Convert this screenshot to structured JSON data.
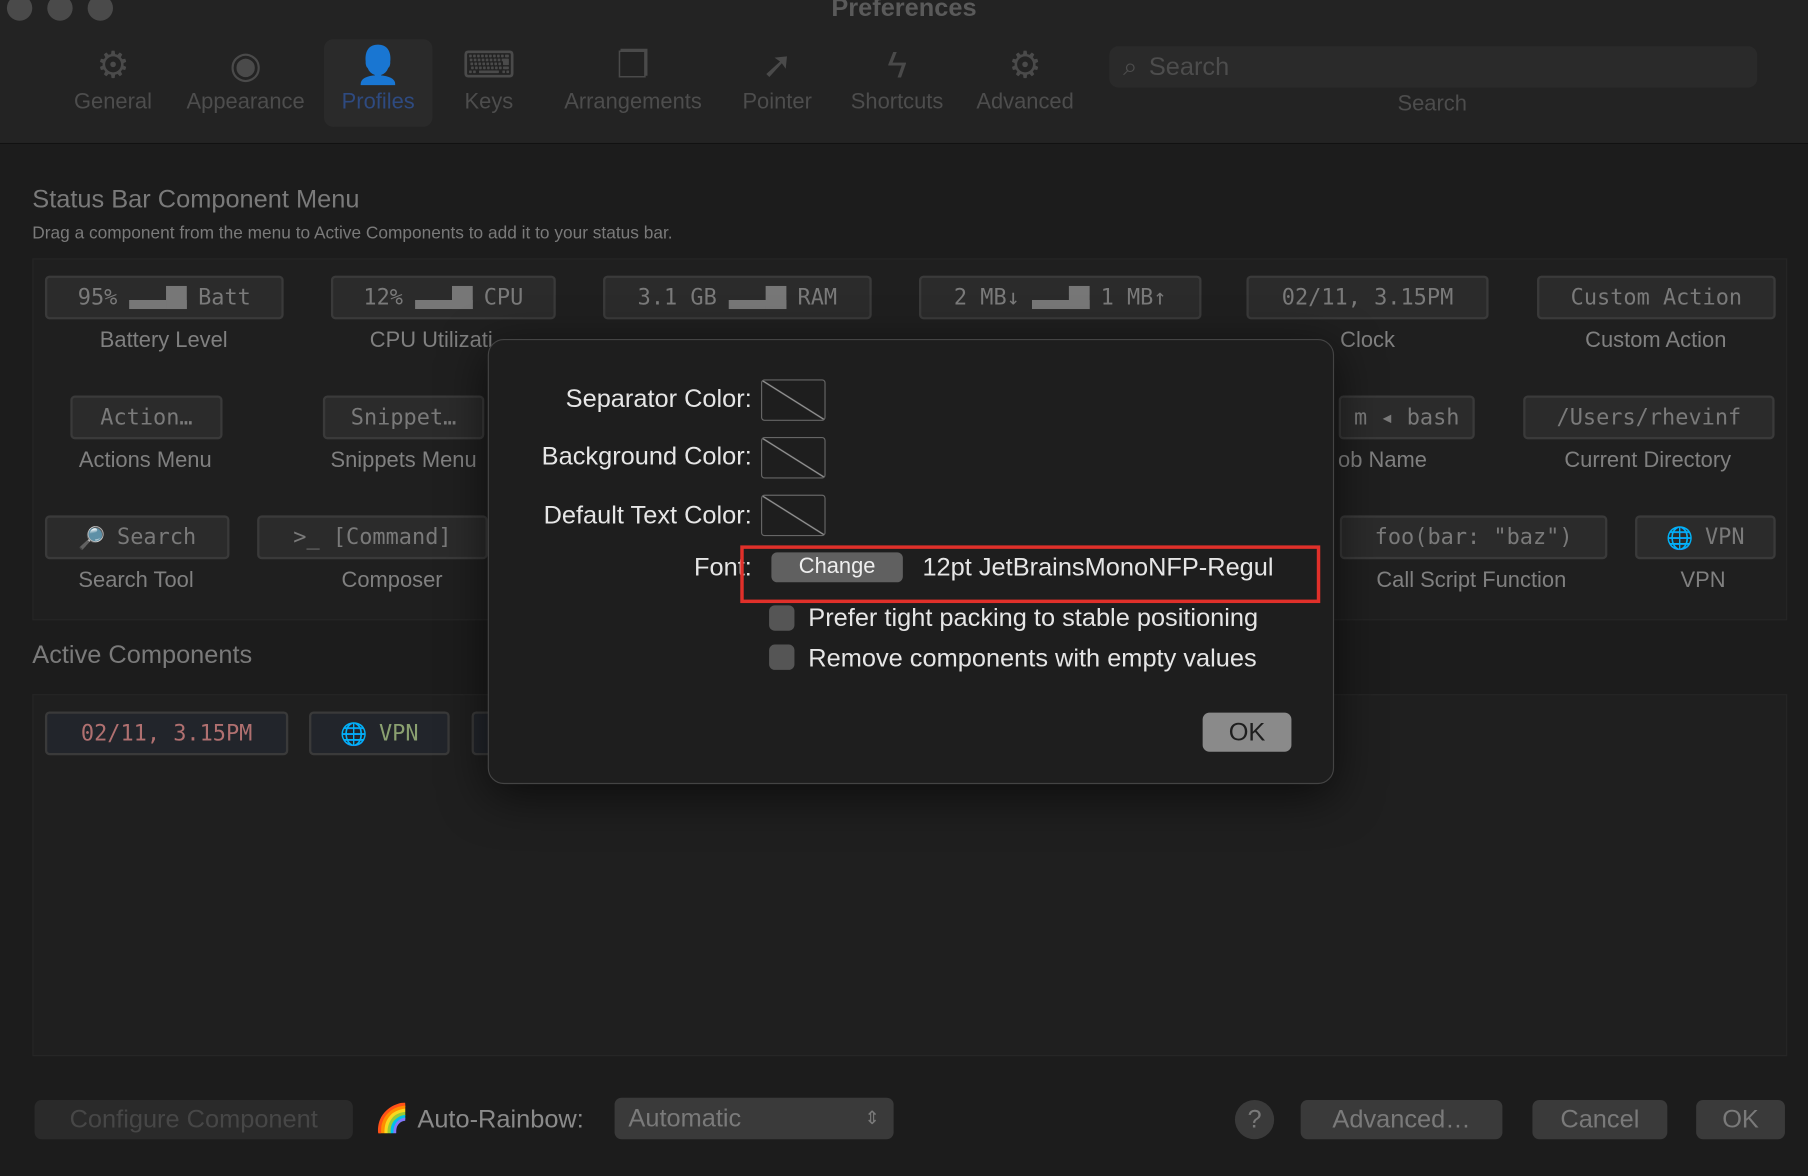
{
  "window": {
    "title": "Preferences"
  },
  "toolbar": {
    "items": [
      {
        "label": "General",
        "icon": "gear-icon",
        "glyph": "⚙"
      },
      {
        "label": "Appearance",
        "icon": "eye-icon",
        "glyph": "◉"
      },
      {
        "label": "Profiles",
        "icon": "person-icon",
        "glyph": "👤"
      },
      {
        "label": "Keys",
        "icon": "keyboard-icon",
        "glyph": "⌨"
      },
      {
        "label": "Arrangements",
        "icon": "windows-icon",
        "glyph": "❐"
      },
      {
        "label": "Pointer",
        "icon": "pointer-icon",
        "glyph": "➚"
      },
      {
        "label": "Shortcuts",
        "icon": "bolt-icon",
        "glyph": "ϟ"
      },
      {
        "label": "Advanced",
        "icon": "gears-icon",
        "glyph": "⚙"
      }
    ],
    "selected": "Profiles",
    "search_placeholder": "Search",
    "search_label": "Search"
  },
  "menu": {
    "title": "Status Bar Component Menu",
    "subtitle": "Drag a component from the menu to Active Components to add it to your status bar.",
    "components": [
      {
        "chip": "95%",
        "chip2": "Batt",
        "label": "Battery Level"
      },
      {
        "chip": "12%",
        "chip2": "CPU",
        "label": "CPU Utilizati"
      },
      {
        "chip": "3.1 GB",
        "chip2": "RAM",
        "label": ""
      },
      {
        "chip": "2 MB↓",
        "chip2": "1 MB↑",
        "label": ""
      },
      {
        "chip": "02/11, 3.15PM",
        "label": "Clock"
      },
      {
        "chip": "Custom Action",
        "label": "Custom Action"
      },
      {
        "chip": "Action…",
        "label": "Actions Menu"
      },
      {
        "chip": "Snippet…",
        "label": "Snippets Menu"
      },
      {
        "chip": "m ◂ bash",
        "label": "ob Name"
      },
      {
        "chip": "/Users/rhevinf",
        "label": "Current Directory"
      },
      {
        "chip": "Search",
        "label": "Search Tool"
      },
      {
        "chip": ">_ [Command]",
        "label": "Composer"
      },
      {
        "chip": "foo(bar: \"baz\")",
        "label": "Call Script Function"
      },
      {
        "chip": "VPN",
        "label": "VPN"
      }
    ]
  },
  "active": {
    "title": "Active Components",
    "items": [
      {
        "chip": "02/11, 3.15PM",
        "color": "#b07070"
      },
      {
        "chip": "VPN",
        "color": "#8aa070"
      }
    ]
  },
  "dialog": {
    "separator_label": "Separator Color:",
    "background_label": "Background Color:",
    "text_label": "Default Text Color:",
    "font_label": "Font:",
    "change_button": "Change",
    "font_value": "12pt JetBrainsMonoNFP-Regul",
    "tight_packing": "Prefer tight packing to stable positioning",
    "remove_empty": "Remove components with empty values",
    "ok": "OK",
    "highlight_color": "#e0302a"
  },
  "footer": {
    "configure": "Configure Component",
    "rainbow_label": "Auto-Rainbow:",
    "rainbow_value": "Automatic",
    "help": "?",
    "advanced": "Advanced…",
    "cancel": "Cancel",
    "ok": "OK"
  }
}
